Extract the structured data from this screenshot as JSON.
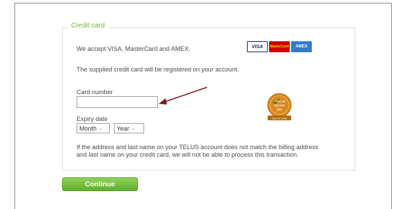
{
  "section": {
    "legend": "Credit card",
    "accepted_text": "We accept VISA, MasterCard and AMEX.",
    "registered_text": "The supplied credit card will be registered on your account.",
    "card_logos": {
      "visa": "VISA",
      "mastercard": "MasterCard",
      "amex": "AMEX"
    },
    "card_number_label": "Card number",
    "card_number_value": "",
    "expiry_label": "Expiry date",
    "month_value": "Month",
    "year_value": "Year",
    "notice_line1": "If the address and last name on your TELUS account does not match the billing address",
    "notice_line2": "and last name on your credit card, we will not be able to process this transaction.",
    "security_badge": {
      "icon": "security-seal-icon",
      "line1": "TELUS",
      "line2": "Secure",
      "line3": "Site",
      "line4": "Click to verify"
    }
  },
  "actions": {
    "continue_label": "Continue"
  },
  "colors": {
    "accent_green": "#6fb33a",
    "annotation_arrow": "#7a1c1c"
  }
}
